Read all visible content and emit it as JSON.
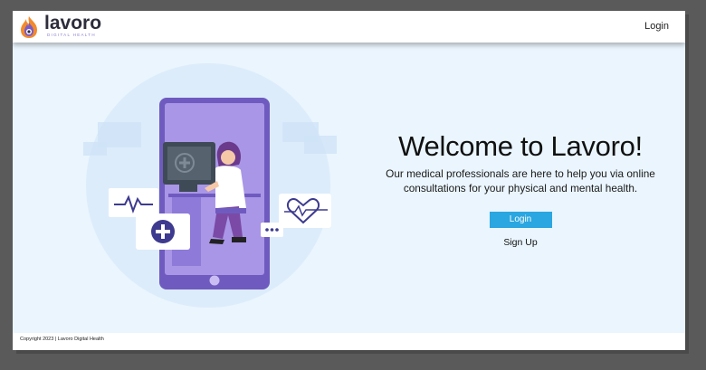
{
  "brand": {
    "name": "lavoro",
    "tagline": "DIGITAL HEALTH",
    "colors": {
      "flame_orange": "#f28a2e",
      "flame_purple": "#7b5cc4",
      "word": "#2c2c3b"
    }
  },
  "header": {
    "login_label": "Login"
  },
  "hero": {
    "title": "Welcome to Lavoro!",
    "subtitle_line1": "Our medical professionals are here to help you via online",
    "subtitle_line2": "consultations for your physical and mental health.",
    "login_label": "Login",
    "signup_label": "Sign Up"
  },
  "illustration": {
    "subject": "doctor-at-computer-in-phone",
    "icons": [
      "heartbeat-icon",
      "plus-icon",
      "heart-pulse-icon",
      "chat-dots-icon"
    ]
  },
  "footer": {
    "copyright": "Copyright 2023 | Lavoro Digital Health"
  },
  "colors": {
    "page_bg": "#eaf5fd",
    "accent_blue": "#2aa6e0",
    "phone_purple": "#8f7ad8",
    "outer_bg": "#5a5a5a"
  }
}
